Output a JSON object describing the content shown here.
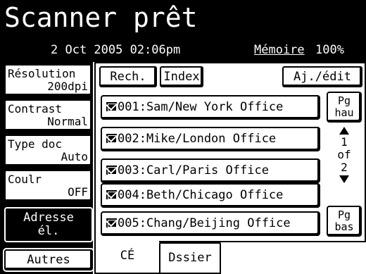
{
  "header": {
    "title": "Scanner prêt",
    "datetime": "2 Oct 2005 02:06pm",
    "memory_label": "Mémoire",
    "memory_value": "100%"
  },
  "settings": [
    {
      "label": "Résolution",
      "value": "200dpi"
    },
    {
      "label": "Contrast",
      "value": "Normal"
    },
    {
      "label": "Type doc",
      "value": "Auto"
    },
    {
      "label": "Coulr",
      "value": "OFF"
    }
  ],
  "address_button": {
    "line1": "Adresse",
    "line2": "él."
  },
  "other_button": "Autres",
  "toolbar": {
    "search": "Rech.",
    "index": "Index",
    "add_edit": "Aj./édit"
  },
  "entries": [
    "001:Sam/New York Office",
    "002:Mike/London Office",
    "003:Carl/Paris Office",
    "004:Beth/Chicago Office",
    "005:Chang/Beijing Office"
  ],
  "pagination": {
    "up_line1": "Pg",
    "up_line2": "hau",
    "down_line1": "Pg",
    "down_line2": "bas",
    "current": "1",
    "of_label": "of",
    "total": "2"
  },
  "tabs": {
    "address_book": "CÉ",
    "folder": "Dssier"
  }
}
